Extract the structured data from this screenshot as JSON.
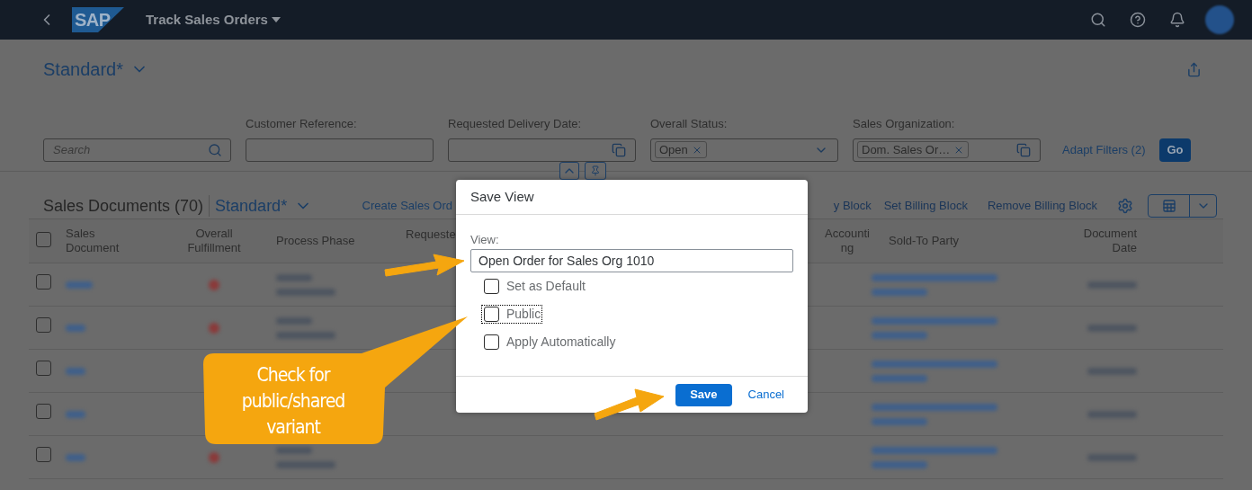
{
  "shell": {
    "logo": "SAP",
    "title": "Track Sales Orders"
  },
  "header": {
    "variant": "Standard*"
  },
  "filters": {
    "search": {
      "placeholder": "Search"
    },
    "fields": [
      {
        "label": "Customer Reference:",
        "kind": "text"
      },
      {
        "label": "Requested Delivery Date:",
        "kind": "valuehelp"
      },
      {
        "label": "Overall Status:",
        "kind": "select",
        "tokens": [
          "Open"
        ]
      },
      {
        "label": "Sales Organization:",
        "kind": "valuehelp",
        "tokens": [
          "Dom. Sales Or…"
        ]
      }
    ],
    "adapt": "Adapt Filters (2)",
    "go": "Go"
  },
  "table": {
    "title": "Sales Documents (70)",
    "variant": "Standard*",
    "select_all": {
      "checked": false
    },
    "actions_left": [
      "Create Sales Ord"
    ],
    "actions_right": [
      "y Block",
      "Set Billing Block",
      "Remove Billing Block"
    ],
    "columns": [
      "Sales Document",
      "Overall Fulfillment",
      "Process Phase",
      "Requeste",
      "Accounti ng",
      "Sold-To Party",
      "Document Date"
    ],
    "rows": [
      {
        "selected": false
      },
      {
        "selected": false
      },
      {
        "selected": false
      },
      {
        "selected": false
      },
      {
        "selected": false
      }
    ]
  },
  "dialog": {
    "title": "Save View",
    "field_label": "View:",
    "value": "Open Order for Sales Org 1010",
    "options": [
      {
        "label": "Set as Default",
        "checked": false,
        "focused": false
      },
      {
        "label": "Public",
        "checked": false,
        "focused": true
      },
      {
        "label": "Apply Automatically",
        "checked": false,
        "focused": false
      }
    ],
    "primary": "Save",
    "secondary": "Cancel"
  },
  "callout": {
    "text": "Check for public/shared variant"
  }
}
